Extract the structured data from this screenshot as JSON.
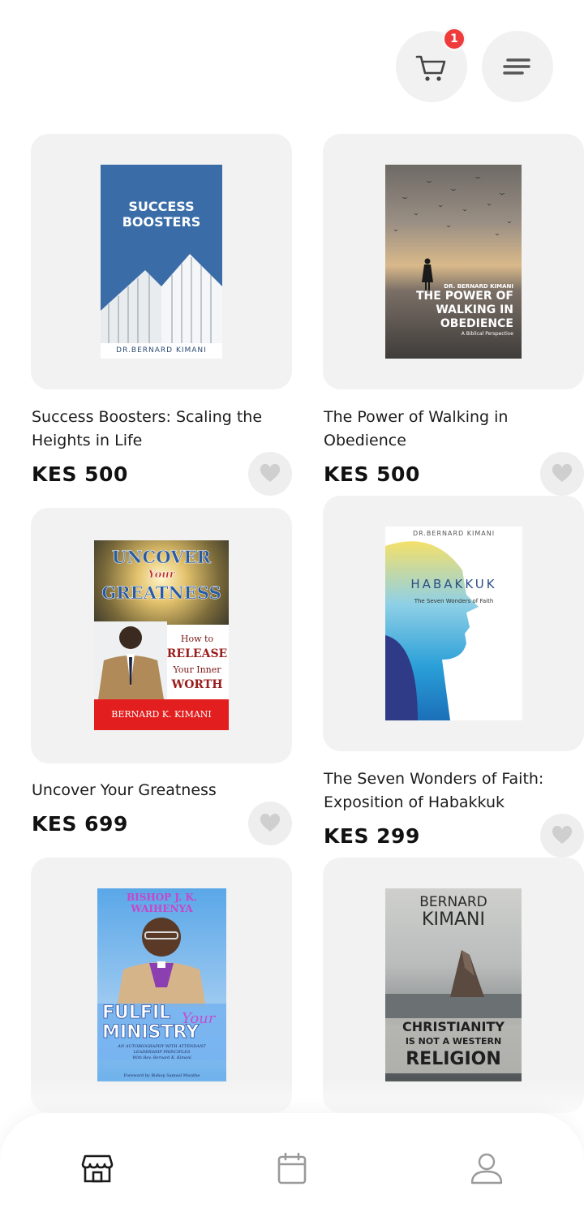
{
  "header": {
    "cart_badge_count": "1",
    "cart_icon": "shopping-cart-icon",
    "menu_icon": "menu-icon"
  },
  "products": [
    {
      "title": "Success Boosters: Scaling the Heights in Life",
      "price": "KES 500",
      "cover": {
        "line1": "SUCCESS",
        "line2": "BOOSTERS",
        "author": "DR.BERNARD KIMANI"
      }
    },
    {
      "title": "The Power of Walking in Obedience",
      "price": "KES 500",
      "cover": {
        "author": "DR. BERNARD KIMANI",
        "line1": "THE POWER OF",
        "line2": "WALKING IN",
        "line3": "OBEDIENCE",
        "sub": "A Biblical Perspective"
      }
    },
    {
      "title": "Uncover Your Greatness",
      "price": "KES 699",
      "cover": {
        "line1": "UNCOVER",
        "line2": "Your",
        "line3": "GREATNESS",
        "howto": "How to",
        "release": "RELEASE",
        "inner": "Your Inner",
        "worth": "WORTH",
        "author": "BERNARD K. KIMANI"
      }
    },
    {
      "title": "The Seven Wonders of Faith: Exposition of Habakkuk",
      "price": "KES 299",
      "cover": {
        "author": "DR.BERNARD KIMANI",
        "line1": "HABAKKUK",
        "sub": "The Seven Wonders of Faith"
      }
    },
    {
      "title": "",
      "price": "",
      "cover": {
        "author": "BISHOP J. K. WAIHENYA",
        "line1": "FULFIL",
        "line2": "Your",
        "line3": "MINISTRY",
        "sub": "AN AUTOBIOGRAPHY WITH ATTENDANT LEADERSHIP PRINCIPLES",
        "with": "With Rev. Bernard K. Kimani",
        "foreword": "Foreword by Bishop Samuel Mwathe"
      }
    },
    {
      "title": "",
      "price": "",
      "cover": {
        "author1": "BERNARD",
        "author2": "KIMANI",
        "line1": "CHRISTIANITY",
        "line2": "IS NOT A WESTERN",
        "line3": "RELIGION"
      }
    }
  ],
  "bottom_nav": {
    "items": [
      "store-icon",
      "calendar-icon",
      "profile-icon"
    ]
  }
}
